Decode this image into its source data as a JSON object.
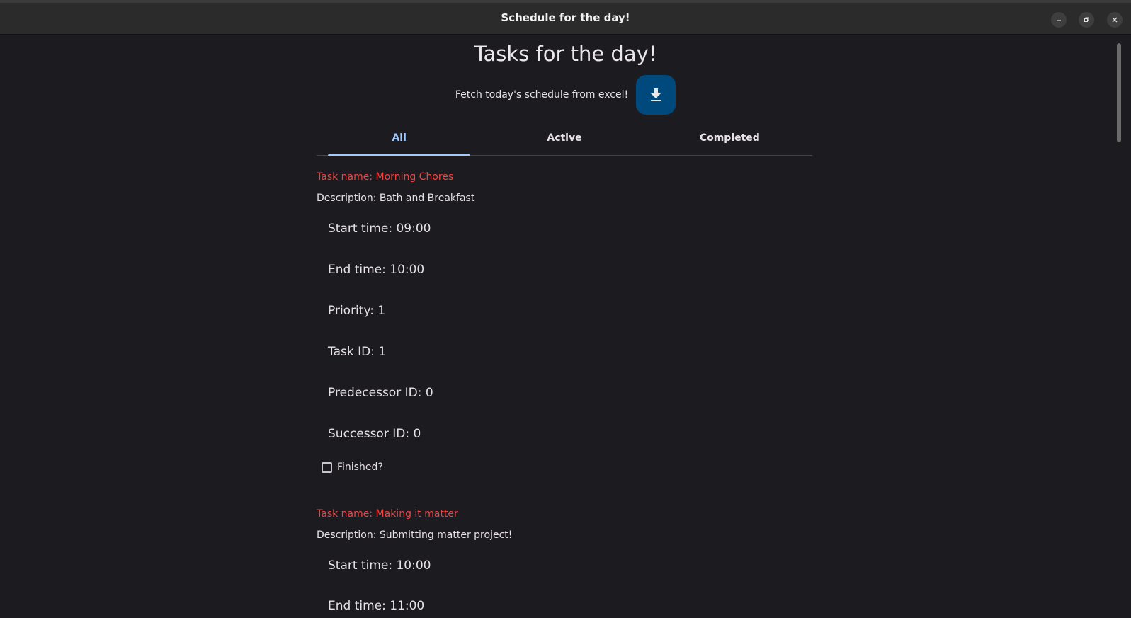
{
  "window": {
    "title": "Schedule for the day!",
    "controls": [
      "minimize",
      "restore",
      "close"
    ]
  },
  "page": {
    "heading": "Tasks for the day!",
    "fetch_label": "Fetch today's schedule from excel!",
    "fetch_button_icon": "download-icon"
  },
  "tabs": [
    {
      "label": "All",
      "active": true
    },
    {
      "label": "Active",
      "active": false
    },
    {
      "label": "Completed",
      "active": false
    }
  ],
  "tasks": [
    {
      "name": "Task name: Morning Chores",
      "description": "Description: Bath and Breakfast",
      "start": "Start time: 09:00",
      "end": "End time: 10:00",
      "priority": "Priority: 1",
      "task_id": "Task ID: 1",
      "predecessor": "Predecessor ID: 0",
      "successor": "Successor ID: 0",
      "finished_label": "Finished?",
      "finished": false
    },
    {
      "name": "Task name: Making it matter",
      "description": "Description: Submitting matter project!",
      "start": "Start time: 10:00",
      "end": "End time: 11:00"
    }
  ],
  "colors": {
    "background": "#1c1b1f",
    "titlebar": "#2b2b2b",
    "accent": "#9fcaff",
    "fab": "#00497d",
    "task_name": "#ef4444"
  }
}
